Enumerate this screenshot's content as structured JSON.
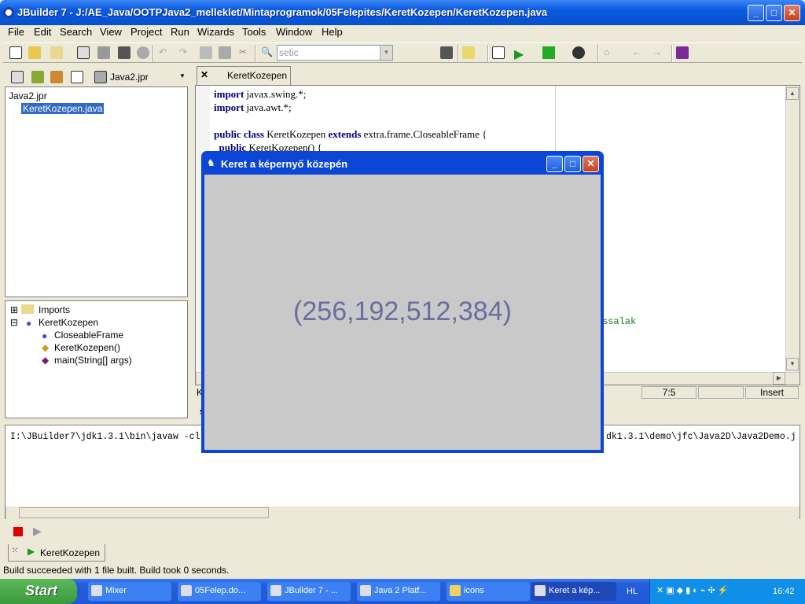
{
  "window": {
    "title": "JBuilder 7 - J:/AE_Java/OOTPJava2_melleklet/Mintaprogramok/05Felepites/KeretKozepen/KeretKozepen.java"
  },
  "menu": [
    {
      "label": "File"
    },
    {
      "label": "Edit"
    },
    {
      "label": "Search"
    },
    {
      "label": "View"
    },
    {
      "label": "Project"
    },
    {
      "label": "Run"
    },
    {
      "label": "Wizards"
    },
    {
      "label": "Tools"
    },
    {
      "label": "Window"
    },
    {
      "label": "Help"
    }
  ],
  "toolbar": {
    "search_value": "setic"
  },
  "project": {
    "selector": "Java2.jpr",
    "tree": [
      "Java2.jpr",
      "KeretKozepen.java"
    ]
  },
  "structure": {
    "items": [
      "Imports",
      "KeretKozepen",
      "CloseableFrame",
      "KeretKozepen()",
      "main(String[] args)"
    ]
  },
  "editor": {
    "tab": "KeretKozepen",
    "lines": [
      {
        "kw": "import",
        "rest": " javax.swing.*;"
      },
      {
        "kw": "import",
        "rest": " java.awt.*;"
      },
      {
        "kw": "public class",
        "rest": " KeretKozepen ",
        "kw2": "extends",
        "rest2": " extra.frame.CloseableFrame {"
      },
      {
        "kw": "  public",
        "rest": " KeretKozepen() {"
      }
    ],
    "comment_fragment": "ssalak",
    "status": {
      "left": "K",
      "position": "7:5",
      "mode": "Insert"
    },
    "lower_tab": "s"
  },
  "messages": {
    "output_left": "I:\\JBuilder7\\jdk1.3.1\\bin\\javaw -cl",
    "output_right": "dk1.3.1\\demo\\jfc\\Java2D\\Java2Demo.j",
    "tab": "KeretKozepen"
  },
  "statusbar": "Build succeeded with 1 file built.  Build took 0 seconds.",
  "dialog": {
    "title": "Keret a képernyő közepén",
    "content": "(256,192,512,384)"
  },
  "taskbar": {
    "start": "Start",
    "tasks": [
      "Mixer",
      "05Felep.do...",
      "JBuilder 7 - ...",
      "Java 2 Platf...",
      "icons",
      "Keret a kép..."
    ],
    "language": "HL",
    "clock": "16:42"
  }
}
